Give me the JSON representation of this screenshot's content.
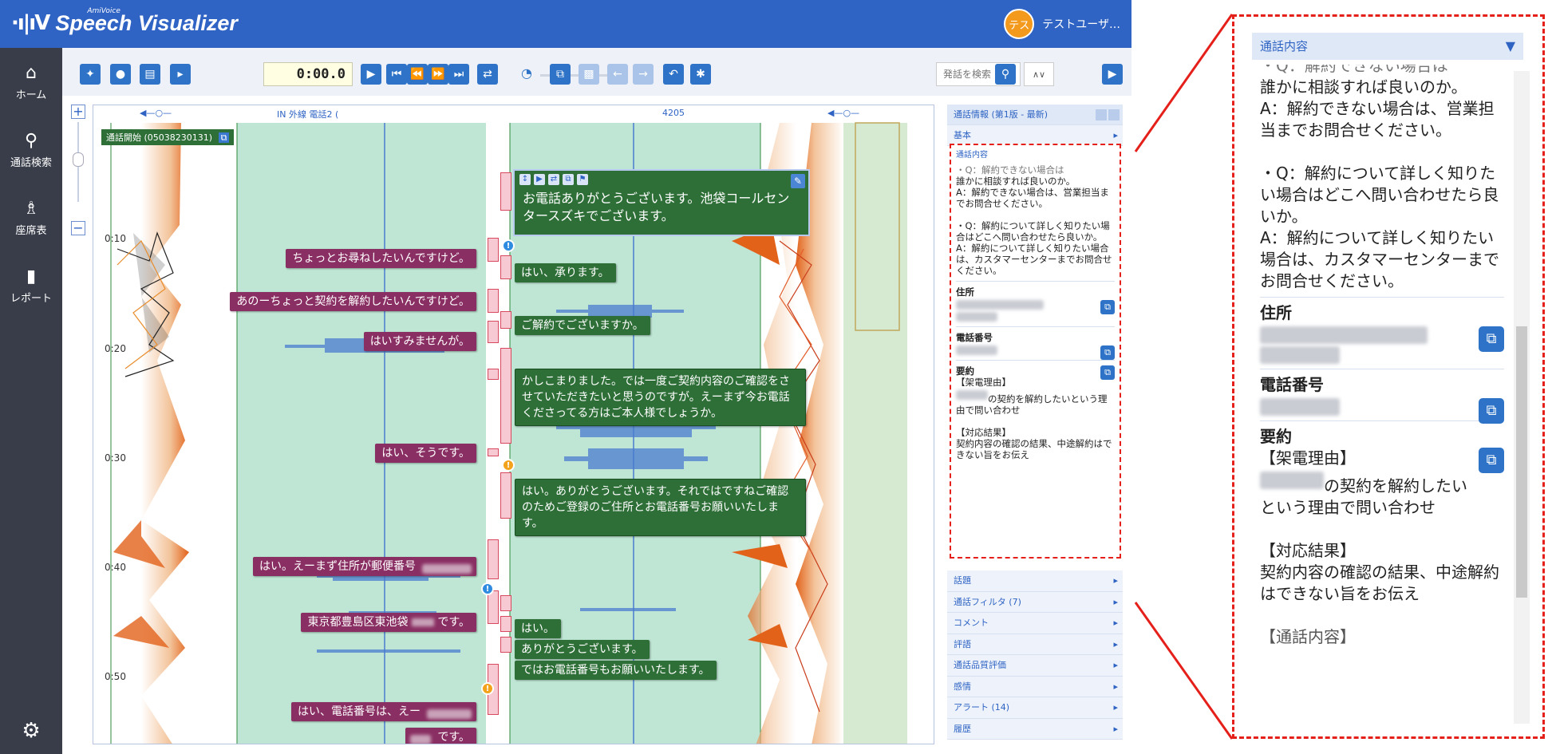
{
  "app": {
    "brand": "AmiVoice",
    "name": "Speech Visualizer",
    "logo_glyph": "·ı|ıV"
  },
  "user": {
    "avatar": "テス",
    "name": "テストユーザ…"
  },
  "nav": [
    {
      "label": "ホーム",
      "icon": "home-icon"
    },
    {
      "label": "通話検索",
      "icon": "chat-search-icon"
    },
    {
      "label": "座席表",
      "icon": "seat-icon"
    },
    {
      "label": "レポート",
      "icon": "bar-chart-icon"
    }
  ],
  "toolbar": {
    "time": "0:00.0",
    "search_placeholder": "発話を検索",
    "search_nav": "∧∨"
  },
  "viz": {
    "channel_label": "IN 外線 電話2 (",
    "channel_id": "4205",
    "start_label": "通話開始 (05038230131)",
    "ticks": [
      "0:10",
      "0:20",
      "0:30",
      "0:40",
      "0:50"
    ],
    "popup_text": "お電話ありがとうございます。池袋コールセンタースズキでございます。",
    "customer_utterances": [
      "ちょっとお尋ねしたいんですけど。",
      "あのーちょっと契約を解約したいんですけど。",
      "はいすみませんが。",
      "はい、そうです。",
      "はい。えーまず住所が郵便番号",
      "東京都豊島区東池袋",
      "です。",
      "はい、電話番号は、えー",
      "です。"
    ],
    "operator_utterances": [
      "はい、承ります。",
      "ご解約でございますか。",
      "かしこまりました。では一度ご契約内容のご確認をさせていただきたいと思うのですが。えーまず今お電話くださってる方はご本人様でしょうか。",
      "はい。ありがとうございます。それではですねご確認のためご登録のご住所とお電話番号お願いいたします。",
      "はい。",
      "ありがとうございます。",
      "ではお電話番号もお願いいたします。"
    ]
  },
  "info": {
    "header": "通話情報 (第1版 - 最新)",
    "basic": "基本",
    "content": "通話内容",
    "qa1_cut": "・Q：解約できない場合は",
    "qa1_q": "誰かに相談すれば良いのか。",
    "qa1_a": "A：解約できない場合は、営業担当までお問合せください。",
    "qa2_q": "・Q：解約について詳しく知りたい場合はどこへ問い合わせたら良いか。",
    "qa2_a": "A：解約について詳しく知りたい場合は、カスタマーセンターまでお問合せください。",
    "address_label": "住所",
    "phone_label": "電話番号",
    "summary_label": "要約",
    "reason_head": "【架電理由】",
    "reason_text": "の契約を解約したいという理由で問い合わせ",
    "result_head": "【対応結果】",
    "result_text": "契約内容の確認の結果、中途解約はできない旨をお伝え",
    "detail_head_cut": "【通話内容】",
    "lower": [
      "話題",
      "通話フィルタ (7)",
      "コメント",
      "評語",
      "通話品質評価",
      "感情",
      "アラート (14)",
      "履歴"
    ]
  }
}
